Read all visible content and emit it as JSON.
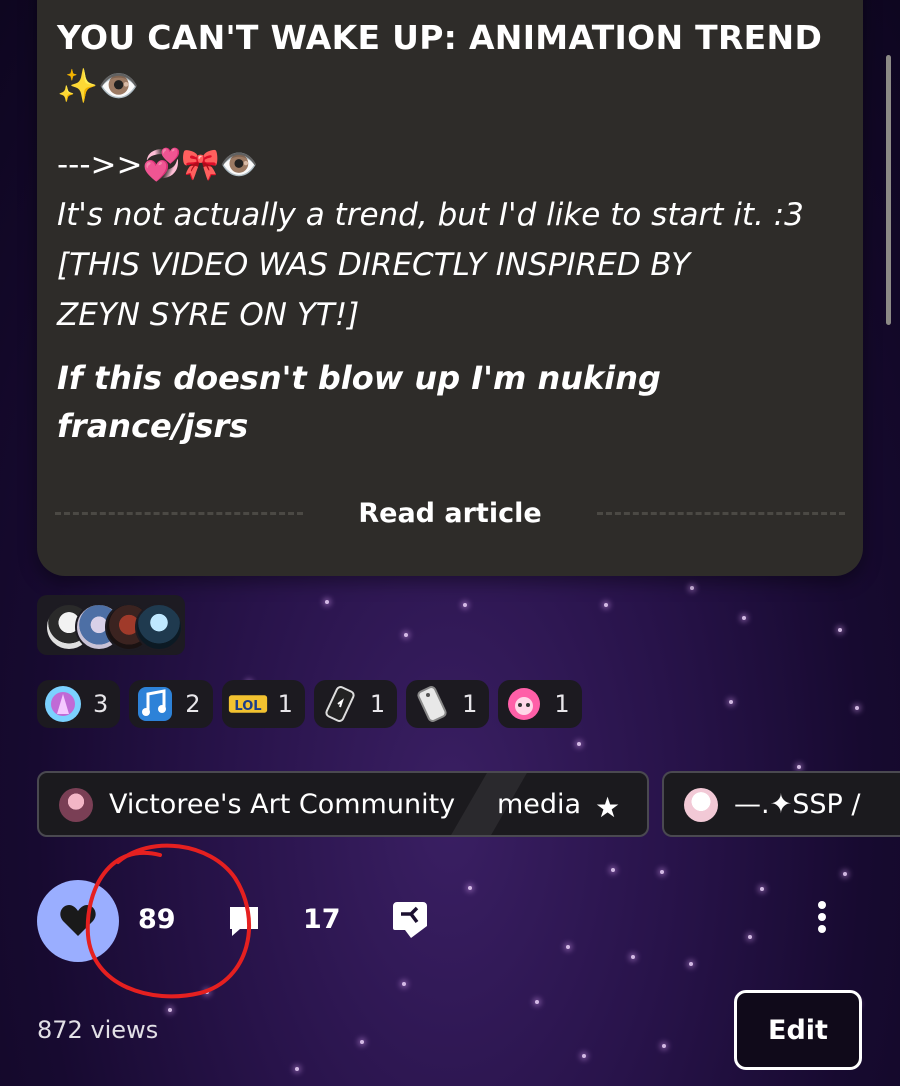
{
  "article": {
    "title_line1": "YOU CAN'T WAKE UP: ANIMATION TREND",
    "title_line2": "✨👁️",
    "arrow_line": "--->>💞🎀👁️",
    "body_line1": "It's not actually a trend, but I'd like to start it. :3",
    "body_line2": "[THIS VIDEO WAS DIRECTLY INSPIRED BY",
    "body_line3": "ZEYN SYRE ON YT!]",
    "bold_line": "If this doesn't blow up I'm nuking france/jsrs",
    "read_label": "Read article"
  },
  "reactions": [
    {
      "icon": "praying-hands-icon",
      "count": "3"
    },
    {
      "icon": "music-notes-icon",
      "count": "2"
    },
    {
      "icon": "lol-icon",
      "count": "1"
    },
    {
      "icon": "phone-dark-icon",
      "count": "1"
    },
    {
      "icon": "phone-light-icon",
      "count": "1"
    },
    {
      "icon": "pink-character-icon",
      "count": "1"
    }
  ],
  "communities": [
    {
      "name": "Victoree's Art Community",
      "category": "media"
    },
    {
      "name": "—.✦SSP /"
    }
  ],
  "actions": {
    "likes": "89",
    "comments": "17",
    "views": "872 views",
    "edit_label": "Edit"
  },
  "colors": {
    "like_button": "#9aaeff",
    "card_bg": "#2e2c29",
    "annotation_red": "#e52020"
  }
}
